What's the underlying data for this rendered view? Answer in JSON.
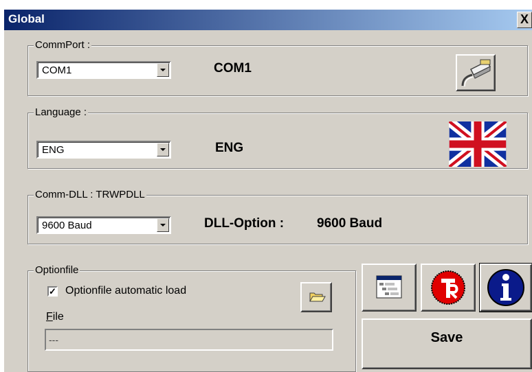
{
  "window": {
    "title": "Global",
    "close_symbol": "X"
  },
  "commport": {
    "group_label": "CommPort :",
    "selected": "COM1",
    "display_value": "COM1",
    "icon": "serial-cable-icon"
  },
  "language": {
    "group_label": "Language :",
    "selected": "ENG",
    "display_value": "ENG",
    "icon": "uk-flag-icon"
  },
  "commdll": {
    "group_label": "Comm-DLL : TRWPDLL",
    "selected": "9600 Baud",
    "option_label": "DLL-Option :",
    "option_value": "9600 Baud"
  },
  "optionfile": {
    "group_label": "Optionfile",
    "checkbox_label": "Optionfile automatic load",
    "checked": true,
    "file_label": "File",
    "file_value": "---",
    "browse_icon": "folder-open-icon"
  },
  "buttons": {
    "settings_icon": "window-settings-icon",
    "trw_icon": "trw-logo-icon",
    "info_icon": "info-icon",
    "save_label": "Save"
  },
  "colors": {
    "title_start": "#0a246a",
    "title_end": "#a6caf0",
    "face": "#d4d0c8",
    "trw_red": "#e00000",
    "info_blue": "#0a1a8a",
    "flag_blue": "#1030a0",
    "flag_red": "#d01020"
  }
}
